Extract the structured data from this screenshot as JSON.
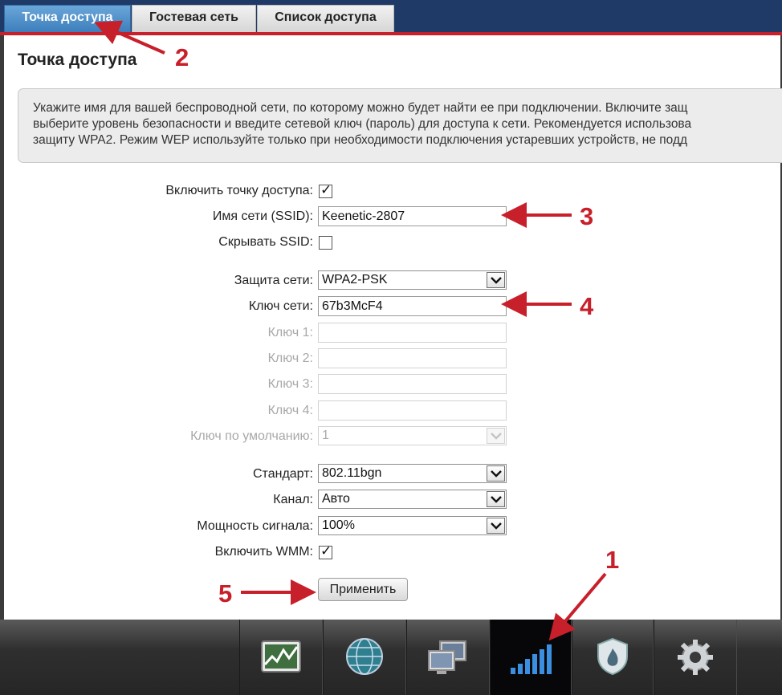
{
  "tabs": [
    {
      "label": "Точка доступа",
      "active": true
    },
    {
      "label": "Гостевая сеть",
      "active": false
    },
    {
      "label": "Список доступа",
      "active": false
    }
  ],
  "page_title": "Точка доступа",
  "info_lines": [
    "Укажите имя для вашей беспроводной сети, по которому можно будет найти ее при подключении. Включите защ",
    "выберите уровень безопасности и введите сетевой ключ (пароль) для доступа к сети. Рекомендуется использова",
    "защиту WPA2. Режим WEP используйте только при необходимости подключения устаревших устройств, не подд"
  ],
  "form": {
    "enable_ap": {
      "label": "Включить точку доступа:",
      "checked": true
    },
    "ssid": {
      "label": "Имя сети (SSID):",
      "value": "Keenetic-2807"
    },
    "hide_ssid": {
      "label": "Скрывать SSID:",
      "checked": false
    },
    "security": {
      "label": "Защита сети:",
      "value": "WPA2-PSK"
    },
    "network_key": {
      "label": "Ключ сети:",
      "value": "67b3McF4"
    },
    "key1": {
      "label": "Ключ 1:",
      "value": ""
    },
    "key2": {
      "label": "Ключ 2:",
      "value": ""
    },
    "key3": {
      "label": "Ключ 3:",
      "value": ""
    },
    "key4": {
      "label": "Ключ 4:",
      "value": ""
    },
    "default_key": {
      "label": "Ключ по умолчанию:",
      "value": "1"
    },
    "standard": {
      "label": "Стандарт:",
      "value": "802.11bgn"
    },
    "channel": {
      "label": "Канал:",
      "value": "Авто"
    },
    "power": {
      "label": "Мощность сигнала:",
      "value": "100%"
    },
    "wmm": {
      "label": "Включить WMM:",
      "checked": true
    },
    "apply_label": "Применить"
  },
  "bottom_icons": [
    "chart-icon",
    "globe-icon",
    "network-computers-icon",
    "wifi-signal-icon",
    "security-shield-icon",
    "gear-icon"
  ],
  "active_bottom_icon": "wifi-signal-icon",
  "annotations": [
    "1",
    "2",
    "3",
    "4",
    "5"
  ],
  "colors": {
    "annotation": "#c8202a",
    "tab_active": "#3d7fbd",
    "topbar": "#1f3a66"
  }
}
